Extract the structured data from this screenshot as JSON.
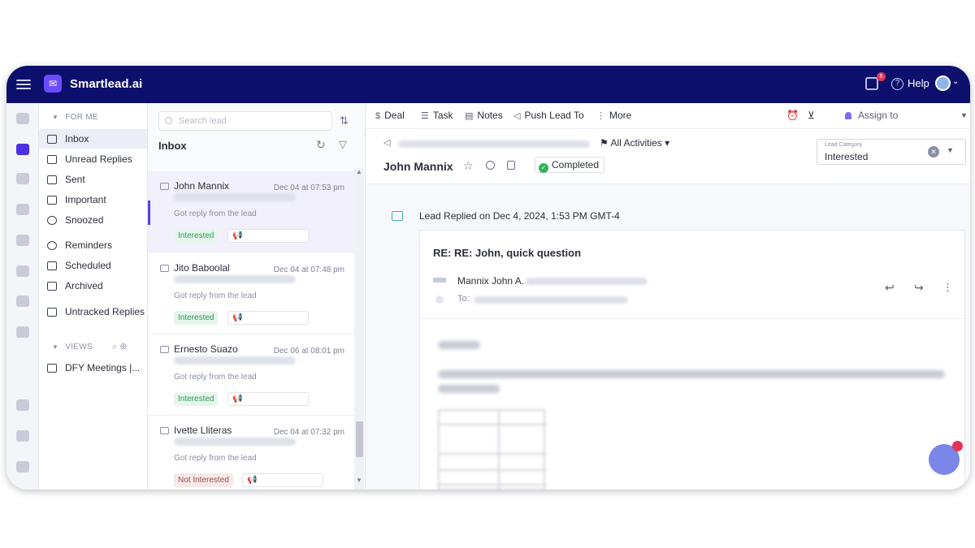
{
  "app": {
    "brand": "Smartlead.ai",
    "help_label": "Help",
    "gift_badge": "5"
  },
  "icons": {
    "menu": "menu-icon",
    "gift": "gift-icon",
    "help": "help-circle-icon",
    "avatar": "user-avatar"
  },
  "folders": {
    "section_for_me": "FOR ME",
    "items": [
      {
        "label": "Inbox",
        "icon": "inbox-icon",
        "active": true
      },
      {
        "label": "Unread Replies",
        "icon": "unread-icon"
      },
      {
        "label": "Sent",
        "icon": "send-icon"
      },
      {
        "label": "Important",
        "icon": "star-icon"
      },
      {
        "label": "Snoozed",
        "icon": "clock-icon"
      },
      {
        "label": "Reminders",
        "icon": "reminder-icon"
      },
      {
        "label": "Scheduled",
        "icon": "scheduled-icon"
      },
      {
        "label": "Archived",
        "icon": "archive-icon"
      },
      {
        "label": "Untracked Replies",
        "icon": "untracked-icon"
      }
    ],
    "section_views": "VIEWS",
    "view_items": [
      {
        "label": "DFY Meetings |..."
      }
    ]
  },
  "lead_list": {
    "search_placeholder": "Search lead",
    "title": "Inbox",
    "leads": [
      {
        "name": "John Mannix",
        "date": "Dec 04 at 07:53 pm",
        "snippet": "Got reply from the lead",
        "tag": "Interested",
        "tag_type": "positive"
      },
      {
        "name": "Jito Baboolal",
        "date": "Dec 04 at 07:48 pm",
        "snippet": "Got reply from the lead",
        "tag": "Interested",
        "tag_type": "positive"
      },
      {
        "name": "Ernesto Suazo",
        "date": "Dec 06 at 08:01 pm",
        "snippet": "Got reply from the lead",
        "tag": "Interested",
        "tag_type": "positive"
      },
      {
        "name": "Ivette Lliteras",
        "date": "Dec 04 at 07:32 pm",
        "snippet": "Got reply from the lead",
        "tag": "Not Interested",
        "tag_type": "negative"
      }
    ]
  },
  "toolbar": {
    "deal": "Deal",
    "task": "Task",
    "notes": "Notes",
    "push_lead": "Push Lead To",
    "more": "More",
    "assign_to": "Assign to"
  },
  "lead_header": {
    "activities": "All Activities",
    "lead_name": "John Mannix",
    "status": "Completed",
    "category_label": "Lead Category",
    "category_value": "Interested"
  },
  "thread": {
    "event": "Lead Replied on Dec 4, 2024, 1:53 PM GMT-4",
    "subject": "RE: RE: John, quick question",
    "sender_name": "Mannix John A.",
    "to_label": "To:"
  },
  "colors": {
    "topbar": "#0c0f6b",
    "accent": "#5b3fe0",
    "positive_tag": "#2f9a56",
    "negative_tag": "#9c4b4b",
    "completed": "#2fb45a"
  }
}
